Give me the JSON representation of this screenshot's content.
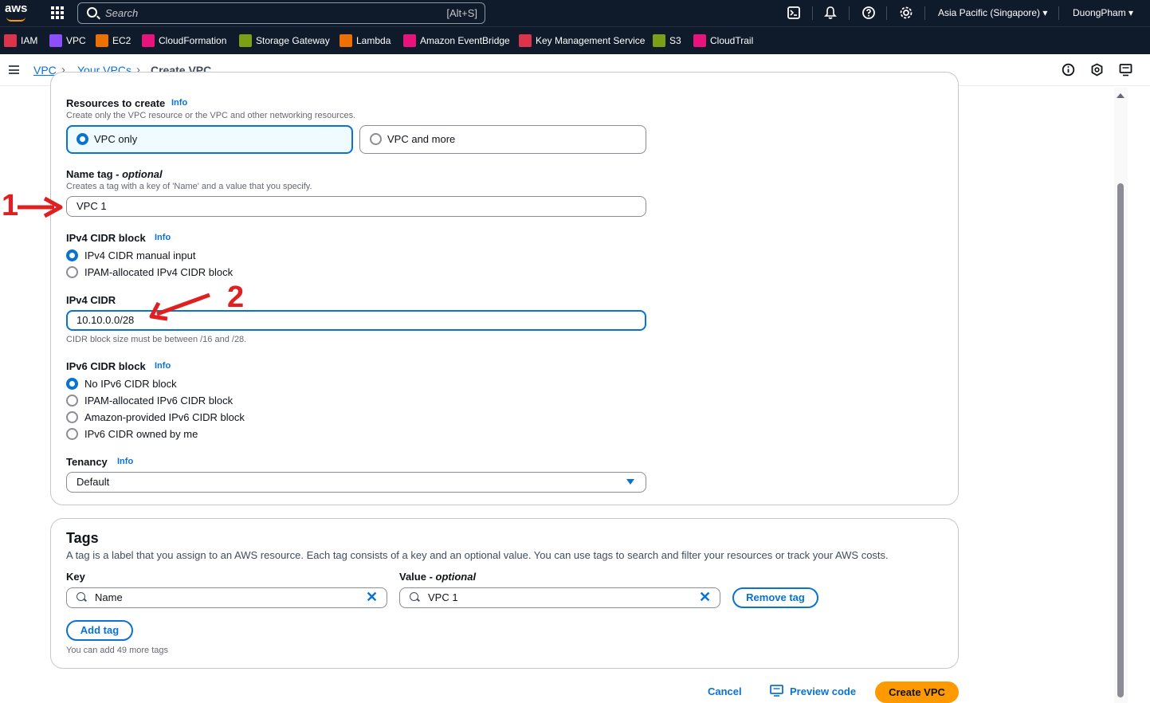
{
  "topbar": {
    "logo_text": "aws",
    "search_placeholder": "Search",
    "search_shortcut": "[Alt+S]",
    "region": "Asia Pacific (Singapore) ▾",
    "user": "DuongPham ▾",
    "icons": [
      "cloudshell-icon",
      "bell-icon",
      "help-icon",
      "gear-icon"
    ]
  },
  "favorites": [
    {
      "label": "IAM",
      "color": "#dd344c"
    },
    {
      "label": "VPC",
      "color": "#8c4fff"
    },
    {
      "label": "EC2",
      "color": "#ed7100"
    },
    {
      "label": "CloudFormation",
      "color": "#e7157b"
    },
    {
      "label": "Storage Gateway",
      "color": "#7aa116"
    },
    {
      "label": "Lambda",
      "color": "#ed7100"
    },
    {
      "label": "Amazon EventBridge",
      "color": "#e7157b"
    },
    {
      "label": "Key Management Service",
      "color": "#dd344c"
    },
    {
      "label": "S3",
      "color": "#7aa116"
    },
    {
      "label": "CloudTrail",
      "color": "#e7157b"
    }
  ],
  "breadcrumb": {
    "root": "VPC",
    "parent": "Your VPCs",
    "current": "Create VPC"
  },
  "settings": {
    "resources": {
      "label": "Resources to create",
      "info": "Info",
      "description": "Create only the VPC resource or the VPC and other networking resources.",
      "options": [
        "VPC only",
        "VPC and more"
      ],
      "selected": "VPC only"
    },
    "name_tag": {
      "label": "Name tag - ",
      "label_optional": "optional",
      "description": "Creates a tag with a key of 'Name' and a value that you specify.",
      "value": "VPC 1"
    },
    "ipv4_block": {
      "label": "IPv4 CIDR block",
      "info": "Info",
      "options": [
        "IPv4 CIDR manual input",
        "IPAM-allocated IPv4 CIDR block"
      ],
      "selected": "IPv4 CIDR manual input"
    },
    "ipv4_cidr": {
      "label": "IPv4 CIDR",
      "value": "10.10.0.0/28",
      "hint": "CIDR block size must be between /16 and /28."
    },
    "ipv6_block": {
      "label": "IPv6 CIDR block",
      "info": "Info",
      "options": [
        "No IPv6 CIDR block",
        "IPAM-allocated IPv6 CIDR block",
        "Amazon-provided IPv6 CIDR block",
        "IPv6 CIDR owned by me"
      ],
      "selected": "No IPv6 CIDR block"
    },
    "tenancy": {
      "label": "Tenancy",
      "info": "Info",
      "value": "Default"
    }
  },
  "tags": {
    "title": "Tags",
    "description": "A tag is a label that you assign to an AWS resource. Each tag consists of a key and an optional value. You can use tags to search and filter your resources or track your AWS costs.",
    "key_label": "Key",
    "value_label": "Value - ",
    "value_label_optional": "optional",
    "rows": [
      {
        "key": "Name",
        "value": "VPC 1"
      }
    ],
    "remove_label": "Remove tag",
    "add_label": "Add tag",
    "remaining": "You can add 49 more tags"
  },
  "footer": {
    "cancel": "Cancel",
    "preview": "Preview code",
    "create": "Create VPC"
  },
  "annotations": {
    "arrow1": "1",
    "arrow2": "2"
  }
}
